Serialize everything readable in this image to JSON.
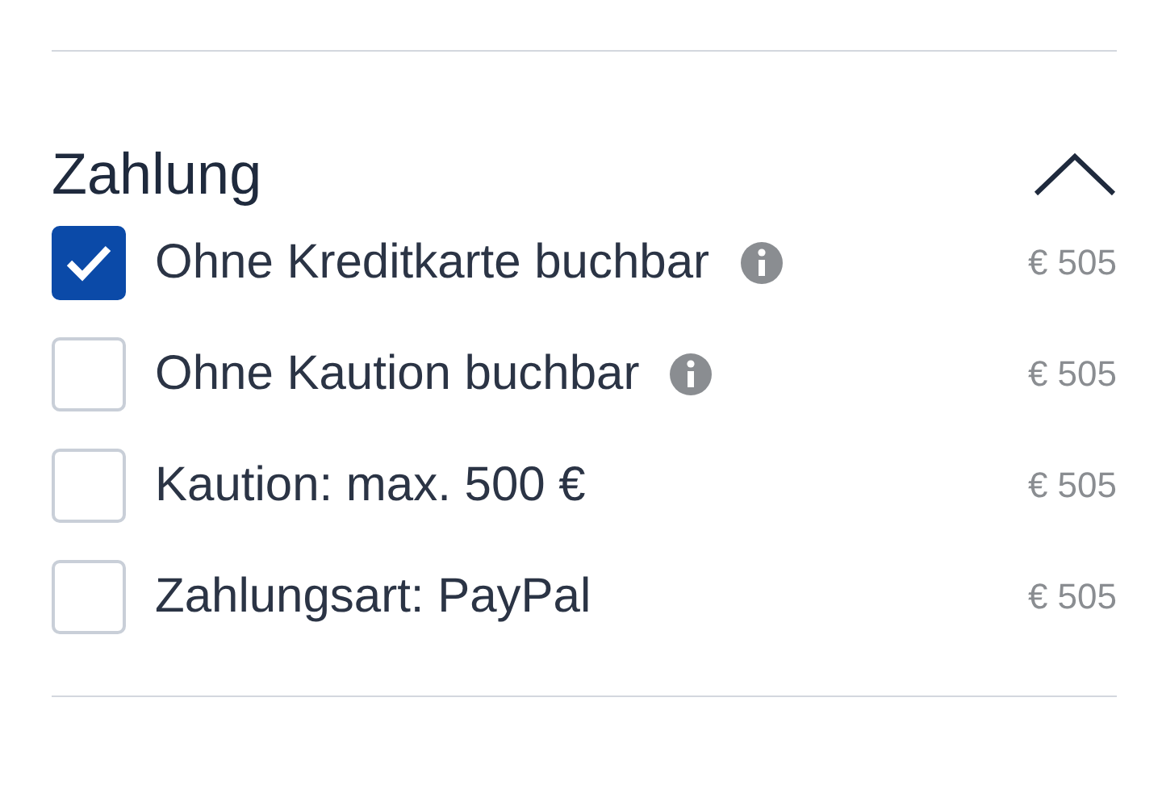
{
  "section": {
    "title": "Zahlung",
    "expanded": true,
    "options": [
      {
        "label": "Ohne Kreditkarte buchbar",
        "info": true,
        "checked": true,
        "price": "€ 505"
      },
      {
        "label": "Ohne Kaution buchbar",
        "info": true,
        "checked": false,
        "price": "€ 505"
      },
      {
        "label": "Kaution: max. 500 €",
        "info": false,
        "checked": false,
        "price": "€ 505"
      },
      {
        "label": "Zahlungsart: PayPal",
        "info": false,
        "checked": false,
        "price": "€ 505"
      }
    ]
  }
}
